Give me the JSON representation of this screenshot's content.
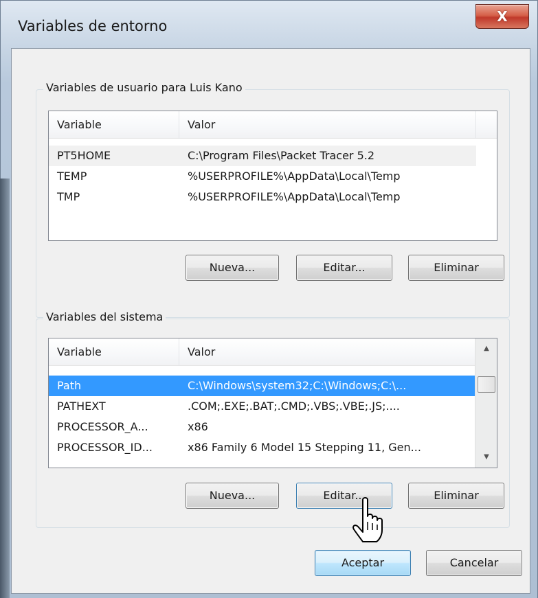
{
  "window": {
    "title": "Variables de entorno",
    "close_icon": "close-x-icon",
    "close_glyph": "X"
  },
  "user_vars": {
    "group_label": "Variables de usuario para Luis Kano",
    "columns": [
      "Variable",
      "Valor"
    ],
    "rows": [
      {
        "variable": "PT5HOME",
        "value": "C:\\Program Files\\Packet Tracer 5.2"
      },
      {
        "variable": "TEMP",
        "value": "%USERPROFILE%\\AppData\\Local\\Temp"
      },
      {
        "variable": "TMP",
        "value": "%USERPROFILE%\\AppData\\Local\\Temp"
      }
    ],
    "buttons": {
      "new": "Nueva...",
      "edit": "Editar...",
      "delete": "Eliminar"
    }
  },
  "system_vars": {
    "group_label": "Variables del sistema",
    "columns": [
      "Variable",
      "Valor"
    ],
    "rows": [
      {
        "variable": "Path",
        "value": "C:\\Windows\\system32;C:\\Windows;C:\\...",
        "selected": true
      },
      {
        "variable": "PATHEXT",
        "value": ".COM;.EXE;.BAT;.CMD;.VBS;.VBE;.JS;...."
      },
      {
        "variable": "PROCESSOR_A...",
        "value": "x86"
      },
      {
        "variable": "PROCESSOR_ID...",
        "value": "x86 Family 6 Model 15 Stepping 11, Gen..."
      }
    ],
    "buttons": {
      "new": "Nueva...",
      "edit": "Editar...",
      "delete": "Eliminar"
    }
  },
  "footer": {
    "ok": "Aceptar",
    "cancel": "Cancelar"
  },
  "colors": {
    "selection": "#3399ff",
    "close_button": "#c0392b",
    "default_button_border": "#3c7fb1"
  }
}
